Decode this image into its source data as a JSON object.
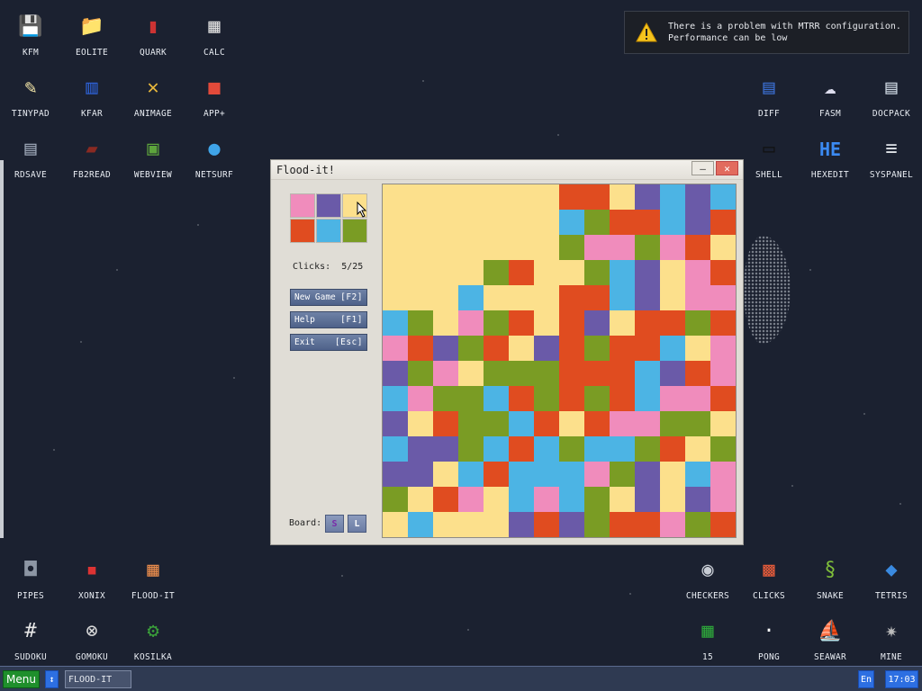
{
  "notification": {
    "line1": "There is a problem with MTRR configuration.",
    "line2": "Performance can be low"
  },
  "desktop_icons": [
    {
      "label": "KFM",
      "icon": "floppy-disk-icon"
    },
    {
      "label": "EOLITE",
      "icon": "folder-icon"
    },
    {
      "label": "QUARK",
      "icon": "notebook-icon"
    },
    {
      "label": "CALC",
      "icon": "calculator-icon"
    },
    {
      "label": "TINYPAD",
      "icon": "notepad-icon"
    },
    {
      "label": "KFAR",
      "icon": "dual-panel-icon"
    },
    {
      "label": "ANIMAGE",
      "icon": "pencil-ruler-icon"
    },
    {
      "label": "APP+",
      "icon": "cube-icon"
    },
    {
      "label": "RDSAVE",
      "icon": "disk-save-icon"
    },
    {
      "label": "FB2READ",
      "icon": "book-icon"
    },
    {
      "label": "WEBVIEW",
      "icon": "browser-window-icon"
    },
    {
      "label": "NETSURF",
      "icon": "globe-icon"
    },
    {
      "label": "DIFF",
      "icon": "diff-icon"
    },
    {
      "label": "FASM",
      "icon": "assembler-icon"
    },
    {
      "label": "DOCPACK",
      "icon": "cabinet-icon"
    },
    {
      "label": "SHELL",
      "icon": "terminal-icon"
    },
    {
      "label": "HEXEDIT",
      "icon": "hex-icon"
    },
    {
      "label": "SYSPANEL",
      "icon": "sliders-icon"
    },
    {
      "label": "PIPES",
      "icon": "pipes-icon"
    },
    {
      "label": "XONIX",
      "icon": "xonix-icon"
    },
    {
      "label": "FLOOD-IT",
      "icon": "color-grid-icon"
    },
    {
      "label": "SUDOKU",
      "icon": "sudoku-icon"
    },
    {
      "label": "GOMOKU",
      "icon": "tic-tac-toe-icon"
    },
    {
      "label": "KOSILKA",
      "icon": "lawnmower-icon"
    },
    {
      "label": "CHECKERS",
      "icon": "checkers-icon"
    },
    {
      "label": "CLICKS",
      "icon": "blocks-icon"
    },
    {
      "label": "SNAKE",
      "icon": "snake-icon"
    },
    {
      "label": "TETRIS",
      "icon": "tetris-icon"
    },
    {
      "label": "15",
      "icon": "fifteen-puzzle-icon"
    },
    {
      "label": "PONG",
      "icon": "pong-icon"
    },
    {
      "label": "SEAWAR",
      "icon": "ship-icon"
    },
    {
      "label": "MINE",
      "icon": "mine-icon"
    }
  ],
  "window": {
    "title": "Flood-it!",
    "clicks_label": "Clicks:",
    "clicks_value": "5/25",
    "buttons": {
      "new_game": "New Game",
      "new_game_key": "[F2]",
      "help": "Help",
      "help_key": "[F1]",
      "exit": "Exit",
      "exit_key": "[Esc]"
    },
    "board_label": "Board:",
    "size_small": "S",
    "size_large": "L",
    "palette": [
      "#f08cbc",
      "#6a5aa8",
      "#fce08c",
      "#e04c20",
      "#4cb4e4",
      "#7a9c24"
    ]
  },
  "taskbar": {
    "menu_label": "Menu",
    "task_label": "FLOOD-IT",
    "lang": "En",
    "clock": "17:03"
  }
}
